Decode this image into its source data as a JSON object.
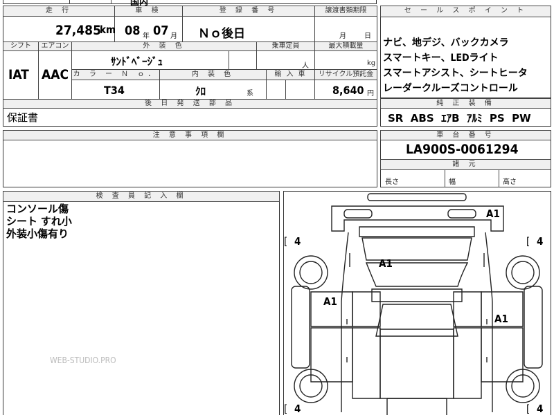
{
  "top_partial_text": "国内",
  "labels": {
    "mileage": "走 行",
    "shaken": "車 検",
    "reg_no": "登 録 番 号",
    "transfer": "譲渡書類期限",
    "sales_point": "セ ー ル ス ポ イ ン ト",
    "shift": "シフト",
    "aircon": "エアコン",
    "ext_color": "外 装 色",
    "capacity": "乗車定員",
    "max_load": "最大積載量",
    "color_no": "カ ラ ー Ｎ ｏ．",
    "int_color": "内 装 色",
    "import": "輸 入 車",
    "recycle": "リサイクル預託金",
    "later_parts": "後 日 発 送 部 品",
    "genuine": "純 正 装 備",
    "notes": "注 意 事 項 欄",
    "chassis": "車 台 番 号",
    "dims": "諸 元",
    "inspector": "検 査 員 記 入 欄"
  },
  "values": {
    "mileage": "27,485",
    "mileage_unit": "km",
    "shaken_year": "08",
    "year_unit": "年",
    "shaken_month": "07",
    "month_unit": "月",
    "reg_no": "Ｎｏ後日",
    "transfer_month": "月",
    "transfer_day": "日",
    "shift": "IAT",
    "aircon": "AAC",
    "ext_color": "ｻﾝﾄﾞﾍﾞｰｼﾞｭ",
    "capacity_unit": "人",
    "load_unit": "kg",
    "color_no": "T34",
    "int_color": "ｸﾛ",
    "int_color_suffix": "系",
    "recycle": "8,640",
    "recycle_unit": "円",
    "later_parts": "保証書",
    "chassis": "LA900S-0061294",
    "dim_length": "長さ",
    "dim_width": "幅",
    "dim_height": "高さ"
  },
  "sales_points": [
    "ナビ、地デジ、バックカメラ",
    "スマートキー、LEDライト",
    "スマートアシスト、シートヒータ",
    "レーダークルーズコントロール"
  ],
  "equipment": "SR  ABS  ｴｱB  ｱﾙﾐ  PS  PW",
  "inspector_notes": [
    "コンソール傷",
    "シート すれ小",
    "外装小傷有り"
  ],
  "diagram_marks": {
    "a1_top_right": "A1",
    "a1_roof": "A1",
    "a1_left": "A1",
    "a1_right": "A1",
    "bracket_open": "[",
    "tread_value": "4"
  },
  "watermark": "WEB-STUDIO.PRO"
}
